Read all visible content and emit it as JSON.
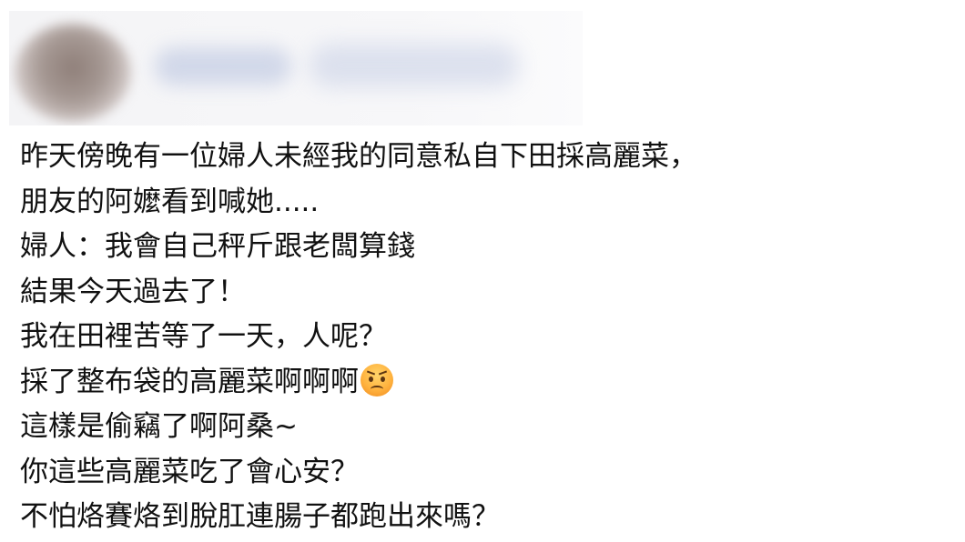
{
  "post": {
    "lines": [
      "昨天傍晚有一位婦人未經我的同意私自下田採高麗菜，",
      "朋友的阿嬤看到喊她.....",
      "婦人：我會自己秤斤跟老闆算錢",
      "結果今天過去了！",
      "我在田裡苦等了一天，人呢？",
      "採了整布袋的高麗菜啊啊啊",
      "這樣是偷竊了啊阿桑~",
      "你這些高麗菜吃了會心安？",
      "不怕烙賽烙到脫肛連腸子都跑出來嗎？"
    ],
    "emoji": "angry-face-icon"
  }
}
